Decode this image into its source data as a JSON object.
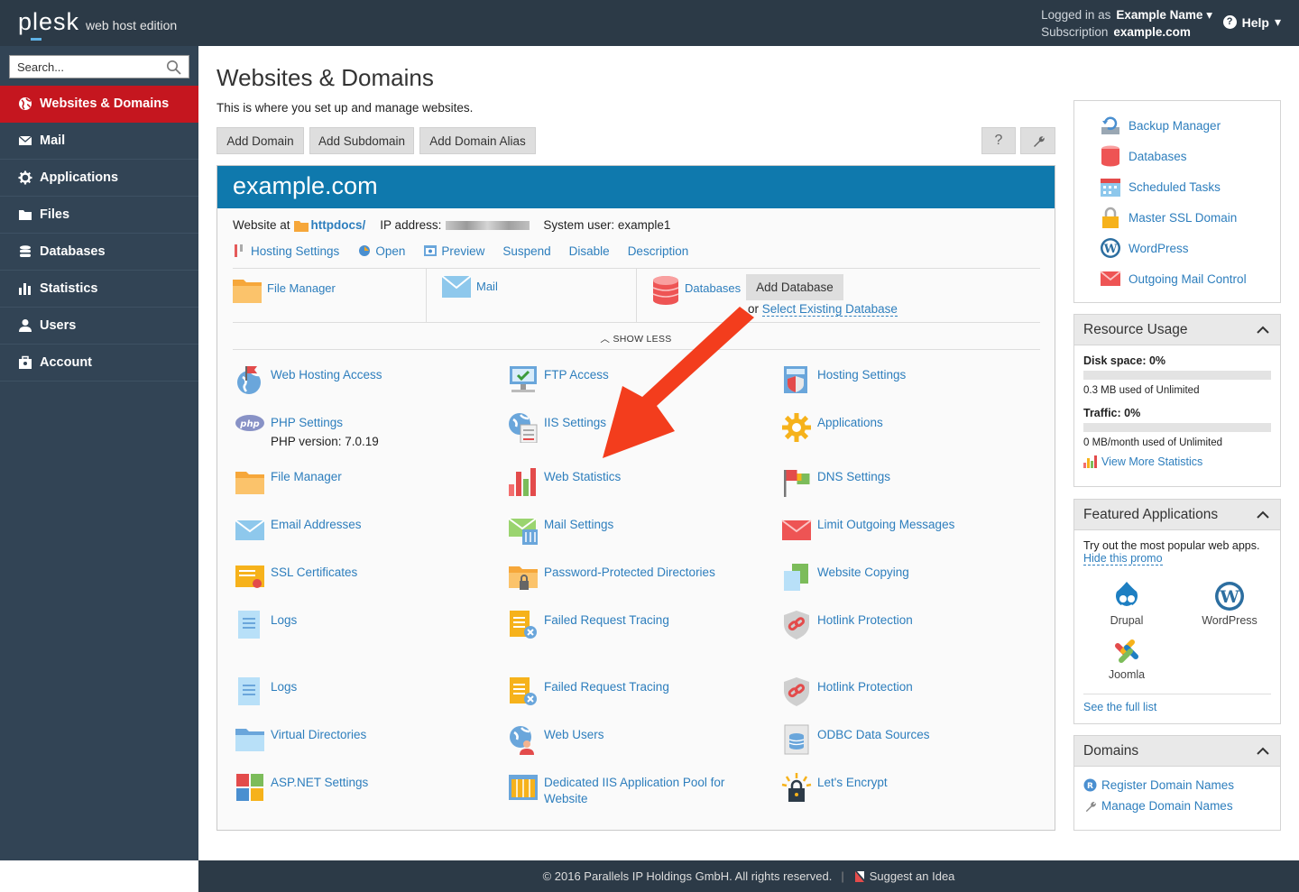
{
  "header": {
    "logo_main": "plesk",
    "logo_edition": "web host edition",
    "logged_in_label": "Logged in as",
    "logged_in_name": "Example Name",
    "subscription_label": "Subscription",
    "subscription_name": "example.com",
    "help_label": "Help"
  },
  "search": {
    "placeholder": "Search..."
  },
  "nav": [
    {
      "label": "Websites & Domains",
      "icon": "globe-icon",
      "active": true
    },
    {
      "label": "Mail",
      "icon": "envelope-icon"
    },
    {
      "label": "Applications",
      "icon": "gear-icon"
    },
    {
      "label": "Files",
      "icon": "folder-icon"
    },
    {
      "label": "Databases",
      "icon": "database-icon"
    },
    {
      "label": "Statistics",
      "icon": "bar-chart-icon"
    },
    {
      "label": "Users",
      "icon": "user-icon"
    },
    {
      "label": "Account",
      "icon": "account-icon"
    }
  ],
  "page": {
    "title": "Websites & Domains",
    "description": "This is where you set up and manage websites.",
    "buttons": [
      "Add Domain",
      "Add Subdomain",
      "Add Domain Alias"
    ],
    "help_button": "?"
  },
  "domain": {
    "name": "example.com",
    "website_at": "Website at",
    "docroot": "httpdocs/",
    "ip_label": "IP address:",
    "sysuser_label": "System user:",
    "sysuser": "example1",
    "actions": [
      "Hosting Settings",
      "Open",
      "Preview",
      "Suspend",
      "Disable",
      "Description"
    ],
    "quick": {
      "file_manager": "File Manager",
      "mail": "Mail",
      "databases": "Databases",
      "add_database": "Add Database",
      "or": "or",
      "select_existing": "Select Existing Database"
    },
    "show_less": "SHOW LESS",
    "tools": [
      [
        "Web Hosting Access",
        "FTP Access",
        "Hosting Settings"
      ],
      [
        "PHP Settings",
        "IIS Settings",
        "Applications"
      ],
      [
        "File Manager",
        "Web Statistics",
        "DNS Settings"
      ],
      [
        "Email Addresses",
        "Mail Settings",
        "Limit Outgoing Messages"
      ],
      [
        "SSL Certificates",
        "Password-Protected Directories",
        "Website Copying"
      ],
      [
        "Logs",
        "Failed Request Tracing",
        "Hotlink Protection"
      ],
      [
        "Logs",
        "Failed Request Tracing",
        "Hotlink Protection"
      ],
      [
        "Virtual Directories",
        "Web Users",
        "ODBC Data Sources"
      ],
      [
        "ASP.NET Settings",
        "Dedicated IIS Application Pool for Website",
        "Let's Encrypt"
      ]
    ],
    "php_version": "PHP version: 7.0.19"
  },
  "right": {
    "links": [
      "Backup Manager",
      "Databases",
      "Scheduled Tasks",
      "Master SSL Domain",
      "WordPress",
      "Outgoing Mail Control"
    ],
    "resource": {
      "title": "Resource Usage",
      "disk_label": "Disk space: 0%",
      "disk_pct": 0,
      "disk_detail": "0.3 MB used of Unlimited",
      "traffic_label": "Traffic: 0%",
      "traffic_pct": 0,
      "traffic_detail": "0 MB/month used of Unlimited",
      "more": "View More Statistics"
    },
    "featured": {
      "title": "Featured Applications",
      "intro": "Try out the most popular web apps.",
      "hide": "Hide this promo",
      "apps": [
        "Drupal",
        "WordPress",
        "Joomla"
      ],
      "see_all": "See the full list"
    },
    "domains": {
      "title": "Domains",
      "links": [
        "Register Domain Names",
        "Manage Domain Names"
      ]
    }
  },
  "footer": {
    "copyright": "© 2016 Parallels IP Holdings GmbH. All rights reserved.",
    "suggest": "Suggest an Idea"
  },
  "colors": {
    "accent": "#0f79ad",
    "nav_active": "#c5161f",
    "sidebar": "#324455",
    "topbar": "#2c3a47",
    "link": "#2d7ebd",
    "arrow": "#f33d1d"
  }
}
